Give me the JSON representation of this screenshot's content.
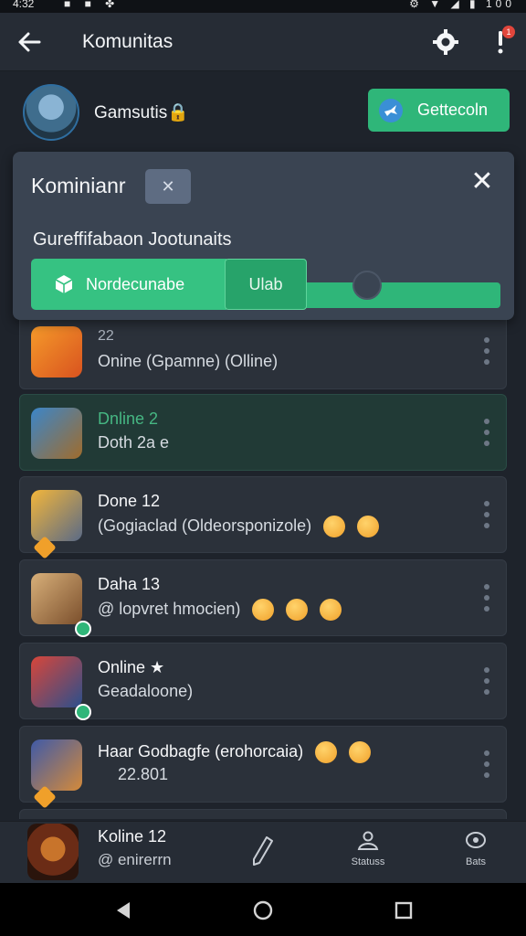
{
  "status_bar": {
    "time": "4:32",
    "left_icons": "■ ■ ✤",
    "right_icons": "⚙ ▼ ◢ ▮ 100"
  },
  "app_bar": {
    "title": "Komunitas"
  },
  "profile": {
    "name": "Gamsutis🔒",
    "action_label": "Gettecoln"
  },
  "notification_count": "1",
  "panel": {
    "title": "Kominianr",
    "chip_label": "✕",
    "close_label": "✕",
    "subtitle": "Gureffifabaon Jootunaits",
    "segment_primary": "Nordecunabe",
    "segment_secondary": "Ulab",
    "slider_level": 0.72
  },
  "list_items": [
    {
      "line1": "22",
      "line2": "Onine (Gpamne) (Olline)"
    },
    {
      "line1": "Dnline 2",
      "line2": "Doth 2a e"
    },
    {
      "line1": "Done 12",
      "line2": "(Gogiaclad (Oldeorsponizole)"
    },
    {
      "line1": "Daha 13",
      "line2": "@ lopvret  hmocien)"
    },
    {
      "line1": "Online ★",
      "line2": "Geadaloone)"
    },
    {
      "line1": "Haar Godbagfe (erohorcaia)",
      "line2": "22.801"
    }
  ],
  "bottom_nav": {
    "name": "Koline 12",
    "subtitle": "@ enirerrn",
    "item_status": "Statuss",
    "item_other": "Bats"
  },
  "colors": {
    "accent": "#2fb679",
    "background": "#1e232b",
    "panel": "#3a4452",
    "row": "#2b313a"
  }
}
